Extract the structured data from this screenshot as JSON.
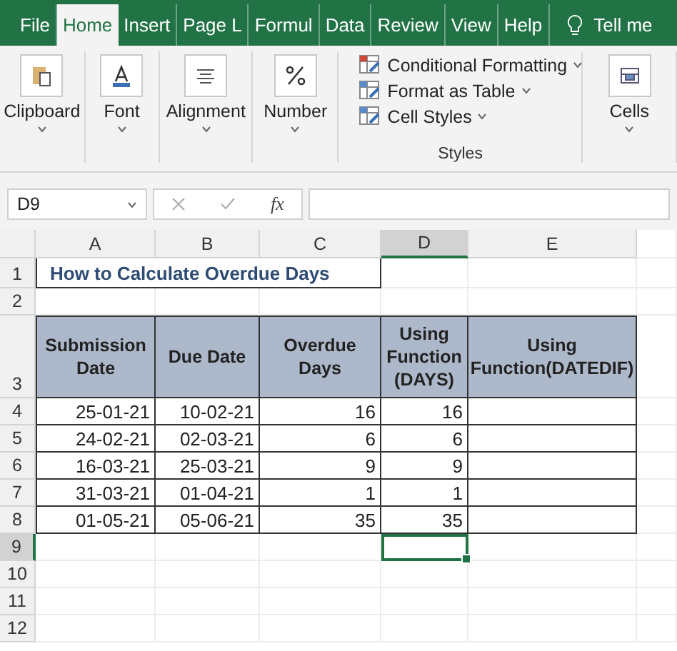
{
  "tabs": [
    {
      "label": "File",
      "selected": false
    },
    {
      "label": "Home",
      "selected": true
    },
    {
      "label": "Insert",
      "selected": false
    },
    {
      "label": "Page L",
      "selected": false
    },
    {
      "label": "Formul",
      "selected": false
    },
    {
      "label": "Data",
      "selected": false
    },
    {
      "label": "Review",
      "selected": false
    },
    {
      "label": "View",
      "selected": false
    },
    {
      "label": "Help",
      "selected": false
    }
  ],
  "tell_me": "Tell me",
  "ribbon": [
    {
      "kind": "button",
      "label": "Clipboard"
    },
    {
      "kind": "button",
      "label": "Font"
    },
    {
      "kind": "button",
      "label": "Alignment"
    },
    {
      "kind": "button",
      "label": "Number"
    },
    {
      "kind": "list",
      "label": "Styles",
      "items": [
        "Conditional Formatting",
        "Format as Table",
        "Cell Styles"
      ]
    },
    {
      "kind": "button",
      "label": "Cells"
    }
  ],
  "formula_bar": {
    "name_box": "D9",
    "function_label": "fx"
  },
  "columns": [
    {
      "label": "A",
      "selected": false
    },
    {
      "label": "B",
      "selected": false
    },
    {
      "label": "C",
      "selected": false
    },
    {
      "label": "D",
      "selected": true
    },
    {
      "label": "E",
      "selected": false
    }
  ],
  "rows": [
    {
      "number": "1",
      "kind": "title",
      "selected": false,
      "title": "How to Calculate Overdue Days"
    },
    {
      "number": "2",
      "kind": "empty",
      "selected": false
    },
    {
      "number": "3",
      "kind": "header",
      "selected": false,
      "cells": [
        "Submission Date",
        "Due Date",
        "Overdue Days",
        "Using Function (DAYS)",
        "Using Function(DATEDIF)"
      ]
    },
    {
      "number": "4",
      "kind": "data",
      "selected": false,
      "cells": [
        "25-01-21",
        "10-02-21",
        "16",
        "16"
      ]
    },
    {
      "number": "5",
      "kind": "data",
      "selected": false,
      "cells": [
        "24-02-21",
        "02-03-21",
        "6",
        "6"
      ]
    },
    {
      "number": "6",
      "kind": "data",
      "selected": false,
      "cells": [
        "16-03-21",
        "25-03-21",
        "9",
        "9"
      ]
    },
    {
      "number": "7",
      "kind": "data",
      "selected": false,
      "cells": [
        "31-03-21",
        "01-04-21",
        "1",
        "1"
      ]
    },
    {
      "number": "8",
      "kind": "data",
      "selected": false,
      "cells": [
        "01-05-21",
        "05-06-21",
        "35",
        "35"
      ]
    },
    {
      "number": "9",
      "kind": "empty",
      "selected": true
    },
    {
      "number": "10",
      "kind": "empty",
      "selected": false
    },
    {
      "number": "11",
      "kind": "empty",
      "selected": false
    },
    {
      "number": "12",
      "kind": "empty",
      "selected": false
    }
  ]
}
